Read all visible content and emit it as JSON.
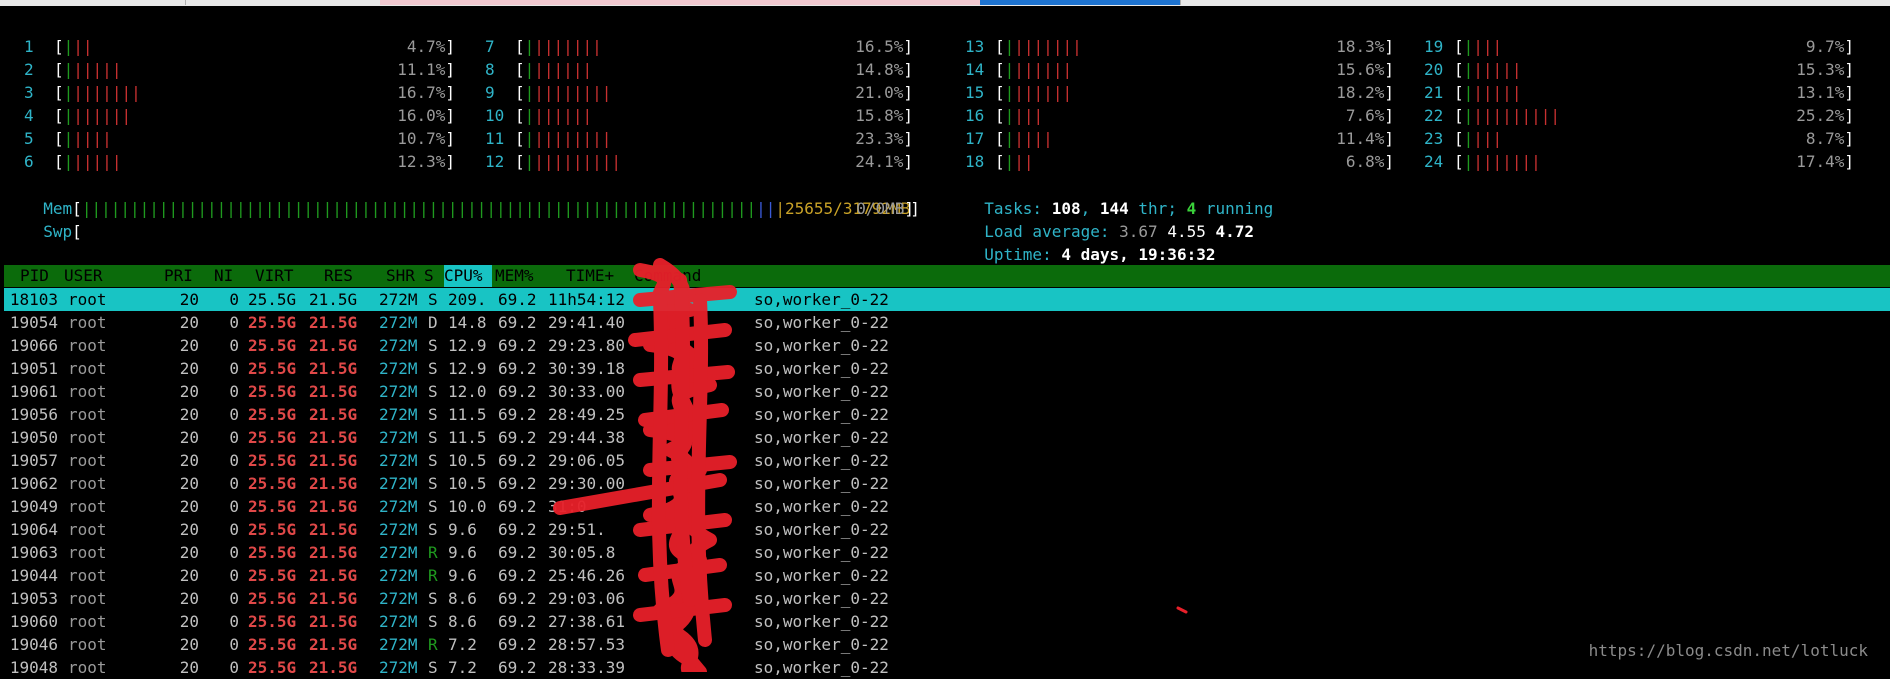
{
  "cpus": [
    {
      "num": "1",
      "bars_g": 1,
      "bars_r": 2,
      "pct": "4.7%"
    },
    {
      "num": "2",
      "bars_g": 1,
      "bars_r": 5,
      "pct": "11.1%"
    },
    {
      "num": "3",
      "bars_g": 1,
      "bars_r": 7,
      "pct": "16.7%"
    },
    {
      "num": "4",
      "bars_g": 1,
      "bars_r": 6,
      "pct": "16.0%"
    },
    {
      "num": "5",
      "bars_g": 1,
      "bars_r": 4,
      "pct": "10.7%"
    },
    {
      "num": "6",
      "bars_g": 1,
      "bars_r": 5,
      "pct": "12.3%"
    },
    {
      "num": "7",
      "bars_g": 1,
      "bars_r": 7,
      "pct": "16.5%"
    },
    {
      "num": "8",
      "bars_g": 1,
      "bars_r": 6,
      "pct": "14.8%"
    },
    {
      "num": "9",
      "bars_g": 1,
      "bars_r": 8,
      "pct": "21.0%"
    },
    {
      "num": "10",
      "bars_g": 1,
      "bars_r": 6,
      "pct": "15.8%"
    },
    {
      "num": "11",
      "bars_g": 1,
      "bars_r": 8,
      "pct": "23.3%"
    },
    {
      "num": "12",
      "bars_g": 1,
      "bars_r": 9,
      "pct": "24.1%"
    },
    {
      "num": "13",
      "bars_g": 1,
      "bars_r": 7,
      "pct": "18.3%"
    },
    {
      "num": "14",
      "bars_g": 1,
      "bars_r": 6,
      "pct": "15.6%"
    },
    {
      "num": "15",
      "bars_g": 1,
      "bars_r": 6,
      "pct": "18.2%"
    },
    {
      "num": "16",
      "bars_g": 1,
      "bars_r": 3,
      "pct": "7.6%"
    },
    {
      "num": "17",
      "bars_g": 1,
      "bars_r": 4,
      "pct": "11.4%"
    },
    {
      "num": "18",
      "bars_g": 1,
      "bars_r": 2,
      "pct": "6.8%"
    },
    {
      "num": "19",
      "bars_g": 1,
      "bars_r": 3,
      "pct": "9.7%"
    },
    {
      "num": "20",
      "bars_g": 1,
      "bars_r": 5,
      "pct": "15.3%"
    },
    {
      "num": "21",
      "bars_g": 1,
      "bars_r": 5,
      "pct": "13.1%"
    },
    {
      "num": "22",
      "bars_g": 1,
      "bars_r": 9,
      "pct": "25.2%"
    },
    {
      "num": "23",
      "bars_g": 1,
      "bars_r": 3,
      "pct": "8.7%"
    },
    {
      "num": "24",
      "bars_g": 1,
      "bars_r": 7,
      "pct": "17.4%"
    }
  ],
  "mem": {
    "label": "Mem",
    "value": "25655/31792MB",
    "bars_g": 70,
    "bars_b": 2,
    "bars_y": 1
  },
  "swp": {
    "label": "Swp",
    "value": "0/0MB"
  },
  "tasks": {
    "label": "Tasks:",
    "count": "108",
    "sep1": ", ",
    "thr": "144",
    "thr_label": " thr; ",
    "running": "4",
    "running_label": " running"
  },
  "load": {
    "label": "Load average:",
    "l1": "3.67",
    "l5": "4.55",
    "l15": "4.72"
  },
  "uptime": {
    "label": "Uptime:",
    "value": "4 days, 19:36:32"
  },
  "columns": {
    "pid": "PID",
    "user": "USER",
    "pri": "PRI",
    "ni": "NI",
    "virt": "VIRT",
    "res": "RES",
    "shr": "SHR",
    "s": "S",
    "cpu": "CPU%",
    "mem": "MEM%",
    "time": "TIME+",
    "cmd": "Command"
  },
  "processes": [
    {
      "pid": "18103",
      "user": "root",
      "pri": "20",
      "ni": "0",
      "virt": "25.5G",
      "res": "21.5G",
      "shr": "272M",
      "s": "S",
      "cpu": "209.",
      "mem": "69.2",
      "time": "11h54:12",
      "cmd": "so,worker_0-22"
    },
    {
      "pid": "19054",
      "user": "root",
      "pri": "20",
      "ni": "0",
      "virt": "25.5G",
      "res": "21.5G",
      "shr": "272M",
      "s": "D",
      "cpu": "14.8",
      "mem": "69.2",
      "time": "29:41.40",
      "cmd": "so,worker_0-22"
    },
    {
      "pid": "19066",
      "user": "root",
      "pri": "20",
      "ni": "0",
      "virt": "25.5G",
      "res": "21.5G",
      "shr": "272M",
      "s": "S",
      "cpu": "12.9",
      "mem": "69.2",
      "time": "29:23.80",
      "cmd": "so,worker_0-22"
    },
    {
      "pid": "19051",
      "user": "root",
      "pri": "20",
      "ni": "0",
      "virt": "25.5G",
      "res": "21.5G",
      "shr": "272M",
      "s": "S",
      "cpu": "12.9",
      "mem": "69.2",
      "time": "30:39.18",
      "cmd": "so,worker_0-22"
    },
    {
      "pid": "19061",
      "user": "root",
      "pri": "20",
      "ni": "0",
      "virt": "25.5G",
      "res": "21.5G",
      "shr": "272M",
      "s": "S",
      "cpu": "12.0",
      "mem": "69.2",
      "time": "30:33.00",
      "cmd": "so,worker_0-22"
    },
    {
      "pid": "19056",
      "user": "root",
      "pri": "20",
      "ni": "0",
      "virt": "25.5G",
      "res": "21.5G",
      "shr": "272M",
      "s": "S",
      "cpu": "11.5",
      "mem": "69.2",
      "time": "28:49.25",
      "cmd": "so,worker_0-22"
    },
    {
      "pid": "19050",
      "user": "root",
      "pri": "20",
      "ni": "0",
      "virt": "25.5G",
      "res": "21.5G",
      "shr": "272M",
      "s": "S",
      "cpu": "11.5",
      "mem": "69.2",
      "time": "29:44.38",
      "cmd": "so,worker_0-22"
    },
    {
      "pid": "19057",
      "user": "root",
      "pri": "20",
      "ni": "0",
      "virt": "25.5G",
      "res": "21.5G",
      "shr": "272M",
      "s": "S",
      "cpu": "10.5",
      "mem": "69.2",
      "time": "29:06.05",
      "cmd": "so,worker_0-22"
    },
    {
      "pid": "19062",
      "user": "root",
      "pri": "20",
      "ni": "0",
      "virt": "25.5G",
      "res": "21.5G",
      "shr": "272M",
      "s": "S",
      "cpu": "10.5",
      "mem": "69.2",
      "time": "29:30.00",
      "cmd": "so,worker_0-22"
    },
    {
      "pid": "19049",
      "user": "root",
      "pri": "20",
      "ni": "0",
      "virt": "25.5G",
      "res": "21.5G",
      "shr": "272M",
      "s": "S",
      "cpu": "10.0",
      "mem": "69.2",
      "time": "31:0",
      "cmd": "so,worker_0-22"
    },
    {
      "pid": "19064",
      "user": "root",
      "pri": "20",
      "ni": "0",
      "virt": "25.5G",
      "res": "21.5G",
      "shr": "272M",
      "s": "S",
      "cpu": "9.6",
      "mem": "69.2",
      "time": "29:51.",
      "cmd": "so,worker_0-22"
    },
    {
      "pid": "19063",
      "user": "root",
      "pri": "20",
      "ni": "0",
      "virt": "25.5G",
      "res": "21.5G",
      "shr": "272M",
      "s": "R",
      "cpu": "9.6",
      "mem": "69.2",
      "time": "30:05.8",
      "cmd": "so,worker_0-22"
    },
    {
      "pid": "19044",
      "user": "root",
      "pri": "20",
      "ni": "0",
      "virt": "25.5G",
      "res": "21.5G",
      "shr": "272M",
      "s": "R",
      "cpu": "9.6",
      "mem": "69.2",
      "time": "25:46.26",
      "cmd": "so,worker_0-22"
    },
    {
      "pid": "19053",
      "user": "root",
      "pri": "20",
      "ni": "0",
      "virt": "25.5G",
      "res": "21.5G",
      "shr": "272M",
      "s": "S",
      "cpu": "8.6",
      "mem": "69.2",
      "time": "29:03.06",
      "cmd": "so,worker_0-22"
    },
    {
      "pid": "19060",
      "user": "root",
      "pri": "20",
      "ni": "0",
      "virt": "25.5G",
      "res": "21.5G",
      "shr": "272M",
      "s": "S",
      "cpu": "8.6",
      "mem": "69.2",
      "time": "27:38.61",
      "cmd": "so,worker_0-22"
    },
    {
      "pid": "19046",
      "user": "root",
      "pri": "20",
      "ni": "0",
      "virt": "25.5G",
      "res": "21.5G",
      "shr": "272M",
      "s": "R",
      "cpu": "7.2",
      "mem": "69.2",
      "time": "28:57.53",
      "cmd": "so,worker_0-22"
    },
    {
      "pid": "19048",
      "user": "root",
      "pri": "20",
      "ni": "0",
      "virt": "25.5G",
      "res": "21.5G",
      "shr": "272M",
      "s": "S",
      "cpu": "7.2",
      "mem": "69.2",
      "time": "28:33.39",
      "cmd": "so,worker_0-22"
    }
  ],
  "watermark": "https://blog.csdn.net/lotluck",
  "colors": {
    "bg": "#000000",
    "cyan": "#2fb4c8",
    "green_bar": "#1f9a1f",
    "red_bar": "#c83030",
    "header_bg": "#0b6b0b",
    "selected_row": "#18c4c4",
    "scribble": "#e8202a"
  }
}
